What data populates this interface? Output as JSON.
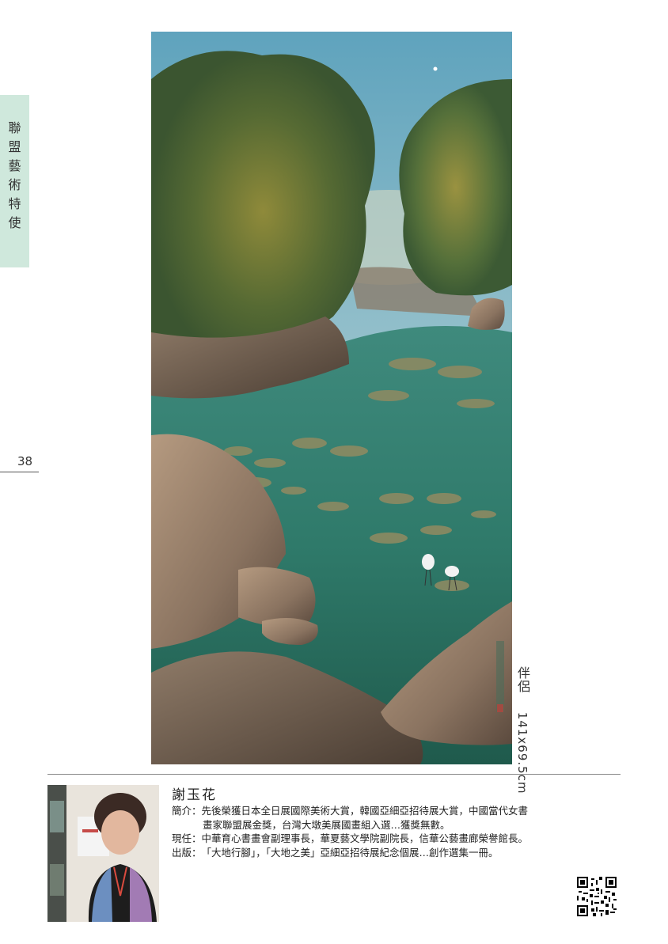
{
  "side_tab": {
    "chars": [
      "聯",
      "盟",
      "藝",
      "術",
      "特",
      "使"
    ]
  },
  "page_number": "38",
  "artwork": {
    "title": "伴侶",
    "size": "141x69.5cm"
  },
  "artist": {
    "name": "謝玉花",
    "bio": [
      {
        "label": "簡介：",
        "text": "先後榮獲日本全日展國際美術大賞，韓國亞細亞招待展大賞，中國當代女書",
        "cont": "畫家聯盟展金獎，台灣大墩美展國畫組入選…獲獎無數。"
      },
      {
        "label": "現任：",
        "text": "中華育心書畫會副理事長，華夏藝文學院副院長，信華公藝畫廊榮譽館長。",
        "cont": ""
      },
      {
        "label": "出版：",
        "text": "「大地行腳」，「大地之美」亞細亞招待展紀念個展…創作選集一冊。",
        "cont": ""
      }
    ]
  },
  "icons": {
    "qr": "qr-code-icon"
  }
}
